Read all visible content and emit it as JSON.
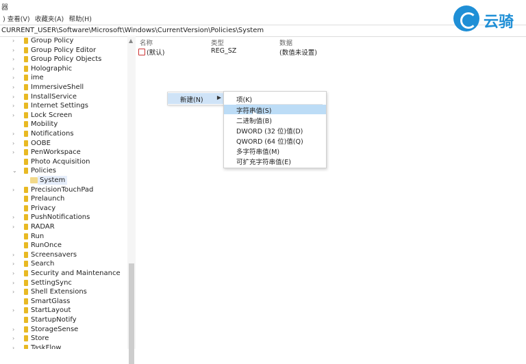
{
  "window": {
    "title": "器"
  },
  "menubar": [
    ") 查看(V)",
    "收藏夹(A)",
    "帮助(H)"
  ],
  "address": "CURRENT_USER\\Software\\Microsoft\\Windows\\CurrentVersion\\Policies\\System",
  "tree": [
    {
      "label": "Group Policy",
      "expandable": true
    },
    {
      "label": "Group Policy Editor",
      "expandable": true
    },
    {
      "label": "Group Policy Objects",
      "expandable": true
    },
    {
      "label": "Holographic",
      "expandable": true
    },
    {
      "label": "ime",
      "expandable": true
    },
    {
      "label": "ImmersiveShell",
      "expandable": true
    },
    {
      "label": "InstallService",
      "expandable": true
    },
    {
      "label": "Internet Settings",
      "expandable": true
    },
    {
      "label": "Lock Screen",
      "expandable": true
    },
    {
      "label": "Mobility",
      "expandable": false
    },
    {
      "label": "Notifications",
      "expandable": true
    },
    {
      "label": "OOBE",
      "expandable": true
    },
    {
      "label": "PenWorkspace",
      "expandable": true
    },
    {
      "label": "Photo Acquisition",
      "expandable": false
    },
    {
      "label": "Policies",
      "expandable": true,
      "expanded": true
    },
    {
      "label": "System",
      "child": true,
      "selected": true
    },
    {
      "label": "PrecisionTouchPad",
      "expandable": true
    },
    {
      "label": "Prelaunch",
      "expandable": false
    },
    {
      "label": "Privacy",
      "expandable": false
    },
    {
      "label": "PushNotifications",
      "expandable": true
    },
    {
      "label": "RADAR",
      "expandable": true
    },
    {
      "label": "Run",
      "expandable": false
    },
    {
      "label": "RunOnce",
      "expandable": false
    },
    {
      "label": "Screensavers",
      "expandable": true
    },
    {
      "label": "Search",
      "expandable": true
    },
    {
      "label": "Security and Maintenance",
      "expandable": true
    },
    {
      "label": "SettingSync",
      "expandable": true
    },
    {
      "label": "Shell Extensions",
      "expandable": true
    },
    {
      "label": "SmartGlass",
      "expandable": false
    },
    {
      "label": "StartLayout",
      "expandable": true
    },
    {
      "label": "StartupNotify",
      "expandable": false
    },
    {
      "label": "StorageSense",
      "expandable": true
    },
    {
      "label": "Store",
      "expandable": true
    },
    {
      "label": "TaskFlow",
      "expandable": true
    }
  ],
  "list": {
    "headers": {
      "name": "名称",
      "type": "类型",
      "data": "数据"
    },
    "rows": [
      {
        "name": "(默认)",
        "type": "REG_SZ",
        "data": "(数值未设置)"
      }
    ]
  },
  "context_menu": {
    "new_label": "新建(N)",
    "arrow": "▶"
  },
  "submenu": [
    {
      "label": "项(K)",
      "highlight": false
    },
    {
      "label": "字符串值(S)",
      "highlight": true
    },
    {
      "label": "二进制值(B)",
      "highlight": false
    },
    {
      "label": "DWORD (32 位)值(D)",
      "highlight": false
    },
    {
      "label": "QWORD (64 位)值(Q)",
      "highlight": false
    },
    {
      "label": "多字符串值(M)",
      "highlight": false
    },
    {
      "label": "可扩充字符串值(E)",
      "highlight": false
    }
  ],
  "watermark": {
    "text": "云骑"
  },
  "colors": {
    "folder": "#e8b923",
    "highlight": "#bcdcf6",
    "brand": "#1f8fd6"
  }
}
